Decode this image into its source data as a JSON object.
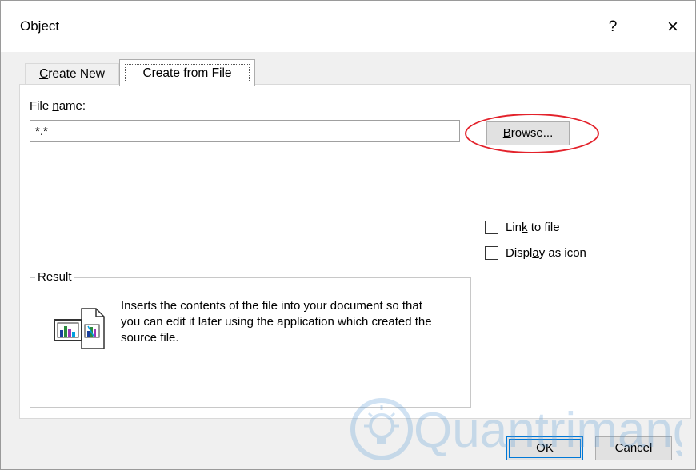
{
  "window": {
    "title": "Object",
    "help_label": "?",
    "close_label": "×"
  },
  "tabs": [
    {
      "label_pre": "",
      "label_key": "C",
      "label_post": "reate New",
      "active": false
    },
    {
      "label_pre": "Create from ",
      "label_key": "F",
      "label_post": "ile",
      "active": true
    }
  ],
  "file_name": {
    "label_pre": "File ",
    "label_key": "n",
    "label_post": "ame:",
    "value": "*.*"
  },
  "browse": {
    "label_key": "B",
    "label_post": "rowse..."
  },
  "options": {
    "link_pre": "Lin",
    "link_key": "k",
    "link_post": " to file",
    "link_checked": false,
    "display_pre": "Displ",
    "display_key": "a",
    "display_post": "y as icon",
    "display_checked": false
  },
  "result": {
    "legend": "Result",
    "text": "Inserts the contents of the file into your document so that you can edit it later using the application which created the source file."
  },
  "buttons": {
    "ok": "OK",
    "cancel": "Cancel"
  },
  "highlight_color": "#e3222b",
  "watermark_text": "Quantrimang"
}
